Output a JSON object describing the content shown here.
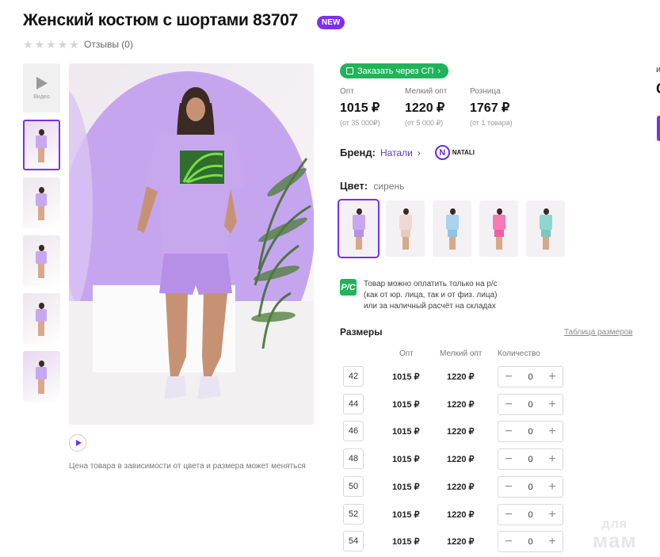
{
  "product": {
    "title": "Женский костюм с шортами 83707",
    "badge": "NEW",
    "rating": 0,
    "reviews_label": "Отзывы (0)"
  },
  "gallery": {
    "video_label": "Видео",
    "price_note": "Цена товара в зависимости от цвета и размера может меняться"
  },
  "order": {
    "sp_button": "Заказать через СП"
  },
  "prices": [
    {
      "label": "Опт",
      "value": "1015 ₽",
      "sub": "(от 35 000₽)"
    },
    {
      "label": "Мелкий опт",
      "value": "1220 ₽",
      "sub": "(от 5 000 ₽)"
    },
    {
      "label": "Розница",
      "value": "1767 ₽",
      "sub": "(от 1 товара)"
    }
  ],
  "brand": {
    "label": "Бренд:",
    "name": "Натали",
    "logo_letter": "N",
    "logo_text": "NATALI"
  },
  "color": {
    "label": "Цвет:",
    "value": "сирень",
    "swatches": [
      "#c7a8ee",
      "#f1d8d2",
      "#a9d3ef",
      "#f57ab8",
      "#8fd6cf"
    ]
  },
  "payment": {
    "icon_text": "Р/С",
    "line1": "Товар можно оплатить только на р/с",
    "line2": "(как от юр. лица, так и от физ. лица)",
    "line3": "или за наличный расчёт на складах"
  },
  "sizes": {
    "title": "Размеры",
    "table_link": "Таблица размеров",
    "col_opt": "Опт",
    "col_mel": "Мелкий опт",
    "col_qty": "Количество",
    "rows": [
      {
        "size": "42",
        "opt": "1015 ₽",
        "mel": "1220 ₽",
        "qty": "0"
      },
      {
        "size": "44",
        "opt": "1015 ₽",
        "mel": "1220 ₽",
        "qty": "0"
      },
      {
        "size": "46",
        "opt": "1015 ₽",
        "mel": "1220 ₽",
        "qty": "0"
      },
      {
        "size": "48",
        "opt": "1015 ₽",
        "mel": "1220 ₽",
        "qty": "0"
      },
      {
        "size": "50",
        "opt": "1015 ₽",
        "mel": "1220 ₽",
        "qty": "0"
      },
      {
        "size": "52",
        "opt": "1015 ₽",
        "mel": "1220 ₽",
        "qty": "0"
      },
      {
        "size": "54",
        "opt": "1015 ₽",
        "mel": "1220 ₽",
        "qty": "0"
      }
    ]
  },
  "right_edge": {
    "letter_i": "и",
    "letter_c": "С"
  },
  "watermark": {
    "line1": "для",
    "line2": "мам"
  },
  "colors": {
    "accent": "#7b2ff0",
    "green": "#21b35a",
    "outfit": "#c7a8ee"
  }
}
